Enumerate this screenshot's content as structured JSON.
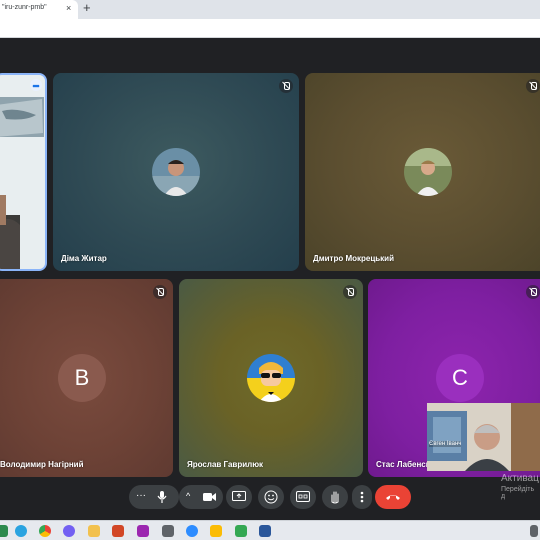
{
  "browser": {
    "tab_title": "\"iru-zunr-pmb\"",
    "close_glyph": "×",
    "new_tab_glyph": "+"
  },
  "participants": [
    {
      "name": "",
      "kind": "camera",
      "speaking": true
    },
    {
      "name": "Діма Житар",
      "kind": "photo",
      "muted": true
    },
    {
      "name": "Дмитро Мокрецький",
      "kind": "photo",
      "muted": true
    },
    {
      "name": "Володимир Нагірний",
      "kind": "letter",
      "letter": "В",
      "muted": true,
      "color": "#7b4a3e"
    },
    {
      "name": "Ярослав Гаврилюк",
      "kind": "illustration",
      "muted": true
    },
    {
      "name": "Стас Лабенсь",
      "kind": "letter",
      "letter": "С",
      "muted": true,
      "color": "#8e24aa"
    }
  ],
  "self_view": {
    "name": "Євген Іванч"
  },
  "watermark": {
    "line1": "Активац",
    "line2": "Перейдіть д"
  },
  "controls": {
    "more_glyph": "···",
    "up_glyph": "^",
    "leave_color": "#ea4335"
  },
  "colors": {
    "background": "#202124",
    "accent": "#8ab4f8"
  }
}
